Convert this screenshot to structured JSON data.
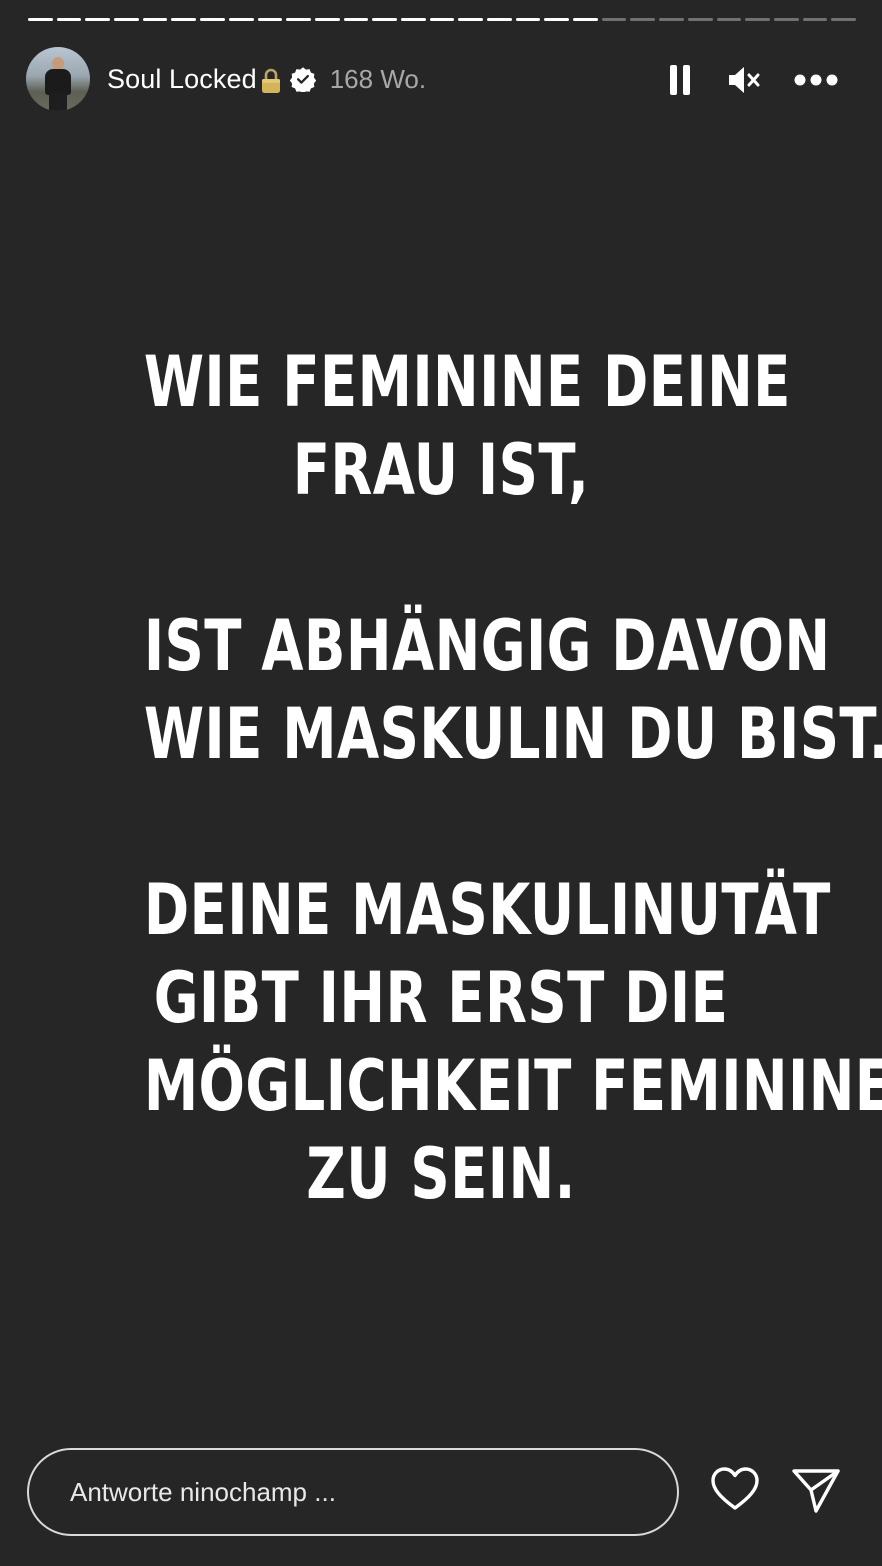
{
  "story": {
    "progress": {
      "segments_total": 29,
      "segments_completed": 20
    },
    "username": "Soul Locked",
    "badge_icons": [
      "lock-icon",
      "verified-badge-icon"
    ],
    "time_ago": "168 Wo.",
    "controls": [
      "pause-icon",
      "mute-icon",
      "more-icon"
    ],
    "text_paragraphs": [
      {
        "lines": [
          "WIE FEMININE DEINE",
          "FRAU IST,"
        ]
      },
      {
        "lines": [
          "IST ABHÄNGIG DAVON",
          "WIE MASKULIN DU BIST."
        ]
      },
      {
        "lines": [
          "DEINE MASKULINUTÄT",
          "GIBT IHR ERST DIE",
          "MÖGLICHKEIT FEMININE",
          "ZU SEIN."
        ]
      }
    ]
  },
  "footer": {
    "reply_placeholder": "Antworte ninochamp ...",
    "icons": [
      "heart-icon",
      "send-icon"
    ]
  },
  "colors": {
    "background": "#262626",
    "text": "#ffffff",
    "muted": "#a8a8a8"
  }
}
